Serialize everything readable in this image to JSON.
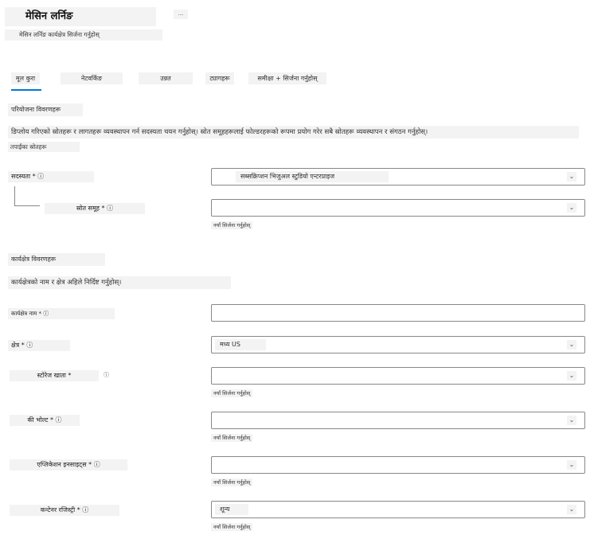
{
  "header": {
    "title": "मेसिन लर्निङ",
    "more": "...",
    "subtitle": "मेसिन लर्निङ कार्यक्षेत्र सिर्जना गर्नुहोस्"
  },
  "tabs": [
    {
      "label": "मूल कुरा",
      "selected": true
    },
    {
      "label": "नेटवर्किङ",
      "selected": false
    },
    {
      "label": "उन्नत",
      "selected": false
    },
    {
      "label": "ट्यागहरू",
      "selected": false
    },
    {
      "label": "समीक्षा + सिर्जना गर्नुहोस्",
      "selected": false
    }
  ],
  "project": {
    "heading": "परियोजना विवरणहरू",
    "description": "डिप्लोय गरिएको स्रोतहरू र लागतहरू व्यवस्थापन गर्न सदस्यता चयन गर्नुहोस्। स्रोत समूहहरूलाई फोल्डरहरूको रूपमा प्रयोग गरेर सबै स्रोतहरू व्यवस्थापन र संगठन गर्नुहोस्।",
    "extra": "तपाईंका स्रोतहरू",
    "subscription_label": "सदस्यता * ⓘ",
    "subscription_value": "सब्सक्रिप्शन भिजुअल स्टुडियो एन्टरप्राइज",
    "resource_group_label": "स्रोत समूह * ⓘ",
    "resource_group_value": "",
    "create_new": "नयाँ सिर्जना गर्नुहोस्"
  },
  "workspace": {
    "heading": "कार्यक्षेत्र विवरणहरू",
    "description": "कार्यक्षेत्रको नाम र क्षेत्र अहिले निर्दिष्ट गर्नुहोस्।",
    "name_label": "कार्यक्षेत्र नाम * ⓘ",
    "name_value": "",
    "region_label": "क्षेत्र * ⓘ",
    "region_value": "मध्य US",
    "storage_label": "स्टोरेज खाता *",
    "storage_help": "ⓘ",
    "key_vault_label": "की भोल्ट * ⓘ",
    "app_insights_label": "एप्लिकेशन इनसाइट्स * ⓘ",
    "registry_label": "कन्टेनर रजिस्ट्री * ⓘ",
    "registry_value": "शून्य",
    "create_new": "नयाँ सिर्जना गर्नुहोस्"
  },
  "chevron": "⌄"
}
